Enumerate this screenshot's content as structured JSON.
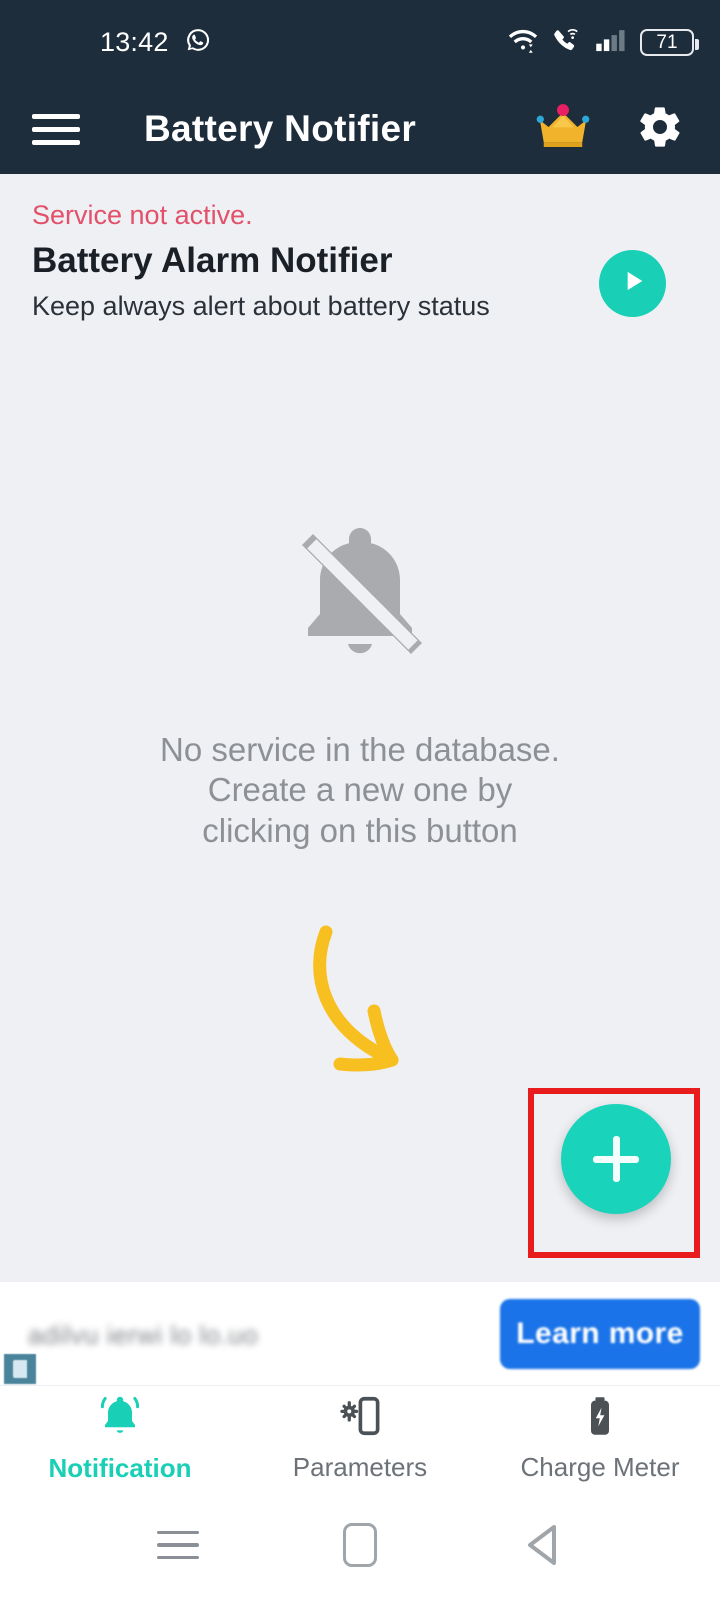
{
  "status_bar": {
    "time": "13:42",
    "icons": [
      "whatsapp-icon",
      "wifi-icon",
      "call-wifi-icon",
      "signal-icon"
    ],
    "battery_level": "71"
  },
  "app_bar": {
    "menu_icon": "hamburger-menu-icon",
    "title": "Battery Notifier",
    "premium_icon": "crown-icon",
    "settings_icon": "gear-icon"
  },
  "service_card": {
    "status": "Service not active.",
    "title": "Battery Alarm Notifier",
    "subtitle": "Keep always alert about battery status",
    "play_icon": "play-icon"
  },
  "empty_state": {
    "icon": "bell-off-icon",
    "line1": "No service in the database.",
    "line2": "Create a new one by",
    "line3": "clicking on this button",
    "arrow_icon": "curved-down-arrow-icon"
  },
  "fab": {
    "icon": "plus-icon",
    "highlight_color": "#e81c1c",
    "color": "#19d3bb"
  },
  "ad_banner": {
    "text": "adilvu ierwi lo lo.uo",
    "cta_label": "Learn more",
    "cta_color": "#1a73e8",
    "adchoices_icon": "adchoices-icon"
  },
  "bottom_nav": {
    "active_color": "#19cfb6",
    "items": [
      {
        "label": "Notification",
        "icon": "bell-ringing-icon",
        "active": true
      },
      {
        "label": "Parameters",
        "icon": "phone-gear-icon",
        "active": false
      },
      {
        "label": "Charge Meter",
        "icon": "battery-bolt-icon",
        "active": false
      }
    ]
  },
  "android_nav": {
    "recents": "recents-icon",
    "home": "home-icon",
    "back": "back-icon"
  },
  "theme": {
    "header_bg": "#1e2d3b",
    "page_bg": "#eff0f4",
    "accent": "#19cfb6",
    "alert": "#e2506a",
    "arrow": "#f7bf20"
  }
}
